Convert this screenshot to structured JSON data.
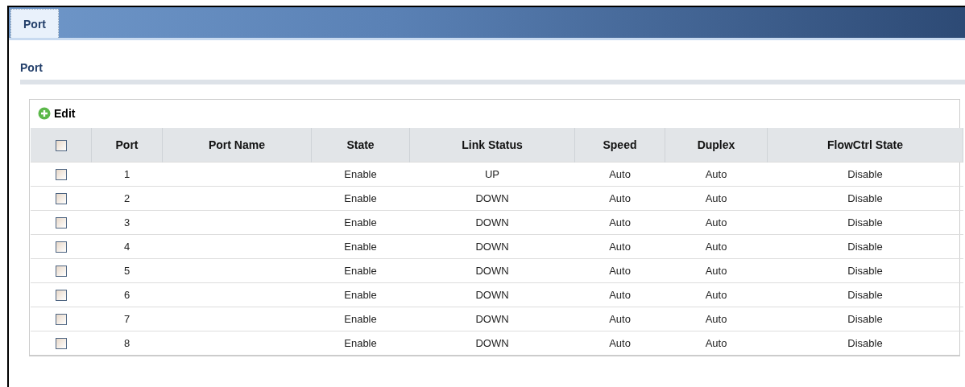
{
  "tabs": [
    {
      "label": "Port",
      "selected": true
    }
  ],
  "section": {
    "title": "Port"
  },
  "toolbar": {
    "edit": "Edit"
  },
  "table": {
    "select_all": {
      "checked": false
    },
    "columns": [
      "Port",
      "Port Name",
      "State",
      "Link Status",
      "Speed",
      "Duplex",
      "FlowCtrl State"
    ],
    "rows": [
      {
        "checked": false,
        "cells": [
          "1",
          "",
          "Enable",
          "UP",
          "Auto",
          "Auto",
          "Disable"
        ]
      },
      {
        "checked": false,
        "cells": [
          "2",
          "",
          "Enable",
          "DOWN",
          "Auto",
          "Auto",
          "Disable"
        ]
      },
      {
        "checked": false,
        "cells": [
          "3",
          "",
          "Enable",
          "DOWN",
          "Auto",
          "Auto",
          "Disable"
        ]
      },
      {
        "checked": false,
        "cells": [
          "4",
          "",
          "Enable",
          "DOWN",
          "Auto",
          "Auto",
          "Disable"
        ]
      },
      {
        "checked": false,
        "cells": [
          "5",
          "",
          "Enable",
          "DOWN",
          "Auto",
          "Auto",
          "Disable"
        ]
      },
      {
        "checked": false,
        "cells": [
          "6",
          "",
          "Enable",
          "DOWN",
          "Auto",
          "Auto",
          "Disable"
        ]
      },
      {
        "checked": false,
        "cells": [
          "7",
          "",
          "Enable",
          "DOWN",
          "Auto",
          "Auto",
          "Disable"
        ]
      },
      {
        "checked": false,
        "cells": [
          "8",
          "",
          "Enable",
          "DOWN",
          "Auto",
          "Auto",
          "Disable"
        ]
      }
    ]
  }
}
